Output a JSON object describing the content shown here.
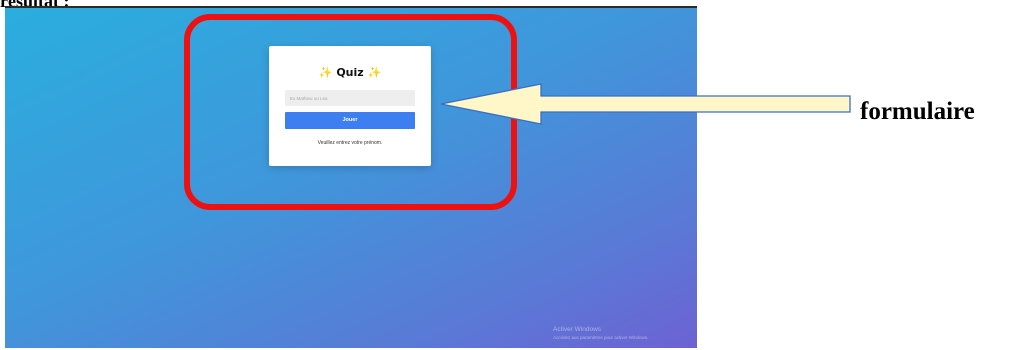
{
  "document": {
    "heading": "résultat :",
    "annotation_label": "formulaire"
  },
  "quiz_form": {
    "title": "Quiz",
    "title_icon": "sparkles-icon",
    "input_placeholder": "Ex Mathieu ou Lea",
    "button_label": "Jouer",
    "hint": "Veuillez entrez votre prénom."
  },
  "os_overlay": {
    "activate_title": "Activer Windows",
    "activate_subtitle": "Accédez aux paramètres pour activer Windows."
  },
  "colors": {
    "gradient_start": "#2aaede",
    "gradient_end": "#6d62d3",
    "button": "#3d7ef0",
    "highlight": "#ee1111",
    "arrow_fill": "#fff7c8"
  }
}
